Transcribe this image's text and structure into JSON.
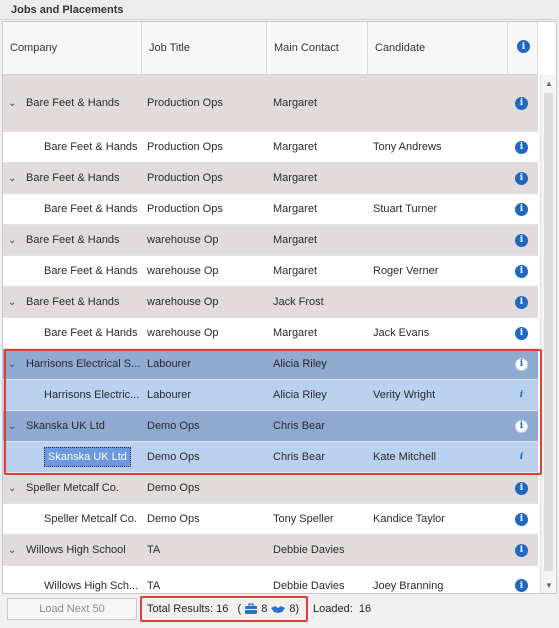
{
  "panel": {
    "title": "Jobs and Placements"
  },
  "columns": {
    "company": "Company",
    "job_title": "Job Title",
    "main_contact": "Main Contact",
    "candidate": "Candidate",
    "info": "i"
  },
  "rows": [
    {
      "kind": "group",
      "company": "Bare Feet & Hands",
      "job": "Production Ops",
      "contact": "Margaret",
      "candidate": ""
    },
    {
      "kind": "child",
      "company": "Bare Feet & Hands",
      "job": "Production Ops",
      "contact": "Margaret",
      "candidate": "Tony Andrews"
    },
    {
      "kind": "group",
      "company": "Bare Feet & Hands",
      "job": "Production Ops",
      "contact": "Margaret",
      "candidate": ""
    },
    {
      "kind": "child",
      "company": "Bare Feet & Hands",
      "job": "Production Ops",
      "contact": "Margaret",
      "candidate": "Stuart Turner"
    },
    {
      "kind": "group",
      "company": "Bare Feet & Hands",
      "job": "warehouse Op",
      "contact": "Margaret",
      "candidate": ""
    },
    {
      "kind": "child",
      "company": "Bare Feet & Hands",
      "job": "warehouse Op",
      "contact": "Margaret",
      "candidate": "Roger Verner"
    },
    {
      "kind": "group",
      "company": "Bare Feet & Hands",
      "job": "warehouse Op",
      "contact": "Jack Frost",
      "candidate": ""
    },
    {
      "kind": "child",
      "company": "Bare Feet & Hands",
      "job": "warehouse Op",
      "contact": "Margaret",
      "candidate": "Jack Evans"
    },
    {
      "kind": "sel-group",
      "company": "Harrisons Electrical S...",
      "job": "Labourer",
      "contact": "Alicia Riley",
      "candidate": ""
    },
    {
      "kind": "sel-child",
      "company": "Harrisons Electric...",
      "job": "Labourer",
      "contact": "Alicia Riley",
      "candidate": "Verity Wright"
    },
    {
      "kind": "sel-group",
      "company": "Skanska UK Ltd",
      "job": "Demo Ops",
      "contact": "Chris Bear",
      "candidate": ""
    },
    {
      "kind": "sel-child",
      "company": "Skanska UK Ltd",
      "job": "Demo Ops",
      "contact": "Chris Bear",
      "candidate": "Kate Mitchell",
      "focused": true
    },
    {
      "kind": "group",
      "company": "Speller Metcalf Co.",
      "job": "Demo Ops",
      "contact": "",
      "candidate": ""
    },
    {
      "kind": "child",
      "company": "Speller Metcalf Co.",
      "job": "Demo Ops",
      "contact": "Tony Speller",
      "candidate": "Kandice Taylor"
    },
    {
      "kind": "group",
      "company": "Willows High School",
      "job": "TA",
      "contact": "Debbie Davies",
      "candidate": ""
    },
    {
      "kind": "child",
      "company": "Willows High Sch...",
      "job": "TA",
      "contact": "Debbie Davies",
      "candidate": "Joey Branning"
    }
  ],
  "footer": {
    "load_next": "Load Next 50",
    "total_label": "Total Results:",
    "total_value": "16",
    "open_paren": "(",
    "jobs_count": "8",
    "placements_count": "8)",
    "loaded_label": "Loaded:",
    "loaded_value": "16"
  },
  "icons": {
    "info": "info-icon",
    "expand": "chevron-down-icon",
    "jobs": "briefcase-icon",
    "placements": "handshake-icon"
  },
  "colors": {
    "highlight": "#e53b3b",
    "accent": "#1f67c4",
    "selected_group": "#8fa9d1",
    "selected_child": "#b9d0ee"
  }
}
